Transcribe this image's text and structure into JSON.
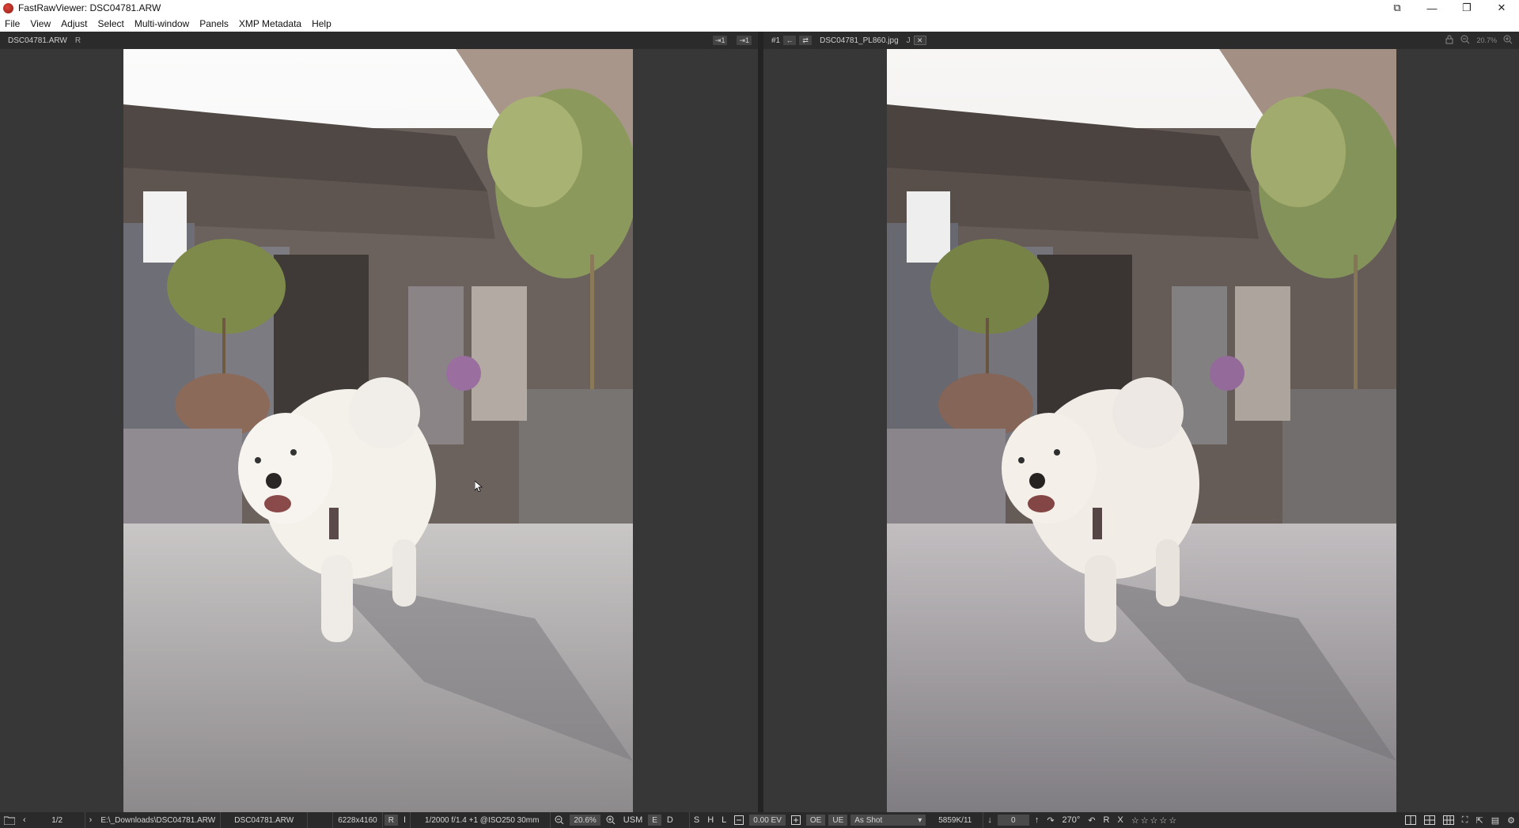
{
  "window": {
    "title": "FastRawViewer: DSC04781.ARW",
    "controls": {
      "display": "⧉",
      "minimize": "—",
      "restore": "❐",
      "close": "✕"
    }
  },
  "menu": [
    "File",
    "View",
    "Adjust",
    "Select",
    "Multi-window",
    "Panels",
    "XMP Metadata",
    "Help"
  ],
  "left_pane": {
    "filename": "DSC04781.ARW",
    "flag": "R",
    "buttons": [
      "⇥1",
      "⇥1"
    ]
  },
  "right_pane": {
    "index": "#1",
    "nav_back": "←",
    "nav_sync": "⇄",
    "filename": "DSC04781_PL860.jpg",
    "mark": "J",
    "close": "✕",
    "zoom": "20.7%"
  },
  "status": {
    "page": "1/2",
    "path": "E:\\_Downloads\\DSC04781.ARW",
    "filename": "DSC04781.ARW",
    "resolution": "6228x4160",
    "raw_flag": "R",
    "info_flag": "I",
    "exposure_info": "1/2000 f/1.4 +1 @ISO250 30mm",
    "zoom": "20.6%",
    "usm": "USM",
    "e": "E",
    "d": "D",
    "s": "S",
    "h": "H",
    "l": "L",
    "ev": "0.00 EV",
    "oe": "OE",
    "ue": "UE",
    "white_balance": "As Shot",
    "wb_value": "5859K/11",
    "tint": "0",
    "rotation": "270°",
    "reject": "R",
    "x": "X",
    "stars": "☆☆☆☆☆"
  },
  "colors": {
    "background": "#373737",
    "header": "#2b2b2b",
    "statusbar": "#2a2a2a"
  },
  "icons": [
    "app-icon",
    "folder-icon",
    "prev-icon",
    "next-icon",
    "zoom-out-icon",
    "zoom-in-icon",
    "minus-icon",
    "plus-icon",
    "arrow-down-icon",
    "arrow-up-icon",
    "rotate-right-icon",
    "rotate-left-icon",
    "lock-icon",
    "magnifier-icon",
    "layout-icons"
  ]
}
